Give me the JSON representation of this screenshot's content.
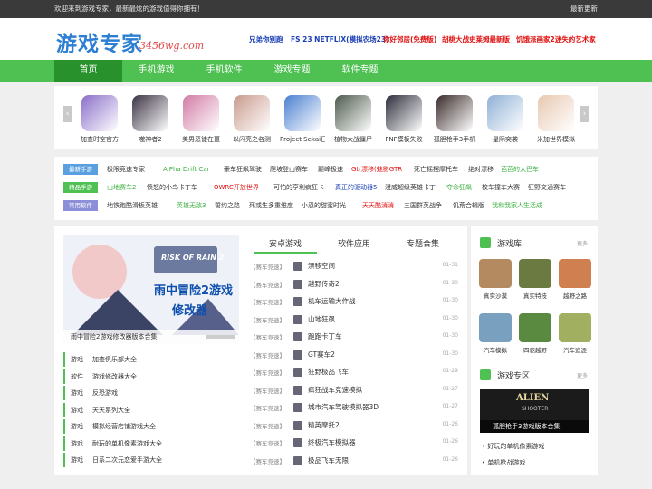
{
  "topbar": {
    "welcome": "欢迎来到游戏专家，最新最炫的游戏值得你拥有！",
    "latest": "最新更新"
  },
  "header": {
    "logo_cn": "游戏专家",
    "logo_en": "3456wg.com",
    "links": [
      {
        "text": "兄弟你别跑",
        "color": "#1a3fb5"
      },
      {
        "text": "FS 23 NETFLIX(模拟农场23)",
        "color": "#1a3fb5"
      },
      {
        "text": "你好邻居(免费版)",
        "color": "#e01010"
      },
      {
        "text": "胡桃大战史莱姆最新版",
        "color": "#e01010"
      },
      {
        "text": "饥饿派画家2迷失的艺术家",
        "color": "#e01010"
      }
    ]
  },
  "nav": [
    "首页",
    "手机游戏",
    "手机软件",
    "游戏专题",
    "软件专题"
  ],
  "carousel": {
    "items": [
      "加查时空官方",
      "噬神者2",
      "美男恶徒在噩",
      "以闪亮之名测",
      "Project Sekai日",
      "植物大战僵尸",
      "FNF模板失败",
      "孤胆枪手3手机",
      "星际突袭",
      "米加世界模拟"
    ],
    "colors": [
      "#8a6ec9",
      "#3b3343",
      "#d27aa4",
      "#c99a8d",
      "#4a7fd0",
      "#4d5a4d",
      "#2b2d3a",
      "#3a2a2a",
      "#8fb0d6",
      "#e8c8b0"
    ]
  },
  "tags": [
    {
      "label": "最新手游",
      "color": "#5aa0e0",
      "links": [
        {
          "t": "极限竞速专家",
          "c": "#333"
        },
        {
          "t": "AlPha Drift Car",
          "c": "#3cb040"
        },
        {
          "t": "豪车狂飙驾驶",
          "c": "#333"
        },
        {
          "t": "爬坡登山赛车",
          "c": "#333"
        },
        {
          "t": "巅峰极速",
          "c": "#333"
        },
        {
          "t": "Gtr漂移(魅影GTR",
          "c": "#e01010"
        },
        {
          "t": "死亡摇摆摩托车",
          "c": "#333"
        },
        {
          "t": "绝对漂移",
          "c": "#333"
        },
        {
          "t": "芭芭的大巴车",
          "c": "#3cb040"
        }
      ]
    },
    {
      "label": "精品手游",
      "color": "#4fc052",
      "links": [
        {
          "t": "山地赛车2",
          "c": "#3cb040"
        },
        {
          "t": "愤怒的小鸟卡丁车",
          "c": "#333"
        },
        {
          "t": "OWRC开放世界",
          "c": "#e01010"
        },
        {
          "t": "可怕的亨利疯狂卡",
          "c": "#333"
        },
        {
          "t": "真正的驱动器5",
          "c": "#1a3fb5"
        },
        {
          "t": "漫威超级英雄卡丁",
          "c": "#333"
        },
        {
          "t": "夺命狂飙",
          "c": "#3cb040"
        },
        {
          "t": "校车撞车大赛",
          "c": "#333"
        },
        {
          "t": "狂野交通赛车",
          "c": "#333"
        }
      ]
    },
    {
      "label": "常用软件",
      "color": "#8c8fd8",
      "links": [
        {
          "t": "地铁跑酷滑板英雄",
          "c": "#333"
        },
        {
          "t": "英雄无敌3",
          "c": "#3cb040"
        },
        {
          "t": "誓约之路",
          "c": "#333"
        },
        {
          "t": "死或生多重维度",
          "c": "#333"
        },
        {
          "t": "小忍的甜蜜时光",
          "c": "#333"
        },
        {
          "t": "天天酷消消",
          "c": "#e01010"
        },
        {
          "t": "三国群英战争",
          "c": "#333"
        },
        {
          "t": "饥荒合辑版",
          "c": "#333"
        },
        {
          "t": "我和我家人生活成",
          "c": "#3cb040"
        }
      ]
    }
  ],
  "featured": {
    "caption": "雨中冒险2游戏修改器版本合集",
    "banner_title": "雨中冒险2游戏",
    "banner_sub": "修改器",
    "logo": "RISK OF RAIN 2"
  },
  "tabs": [
    "安卓游戏",
    "软件应用",
    "专题合集"
  ],
  "list": [
    {
      "c": "【赛车竞速】",
      "t": "漂移空间",
      "d": "01-31"
    },
    {
      "c": "【赛车竞速】",
      "t": "越野传奇2",
      "d": "01-30"
    },
    {
      "c": "【赛车竞速】",
      "t": "机车运输大作战",
      "d": "01-30"
    },
    {
      "c": "【赛车竞速】",
      "t": "山地狂飙",
      "d": "01-30"
    },
    {
      "c": "【赛车竞速】",
      "t": "跑跑卡丁车",
      "d": "01-30"
    },
    {
      "c": "【赛车竞速】",
      "t": "GT赛车2",
      "d": "01-30"
    },
    {
      "c": "【赛车竞速】",
      "t": "狂野极品飞车",
      "d": "01-29"
    },
    {
      "c": "【赛车竞速】",
      "t": "疯狂战车竞速模拟",
      "d": "01-27"
    },
    {
      "c": "【赛车竞速】",
      "t": "城市汽车驾驶模拟器3D",
      "d": "01-27"
    },
    {
      "c": "【赛车竞速】",
      "t": "精英摩托2",
      "d": "01-26"
    },
    {
      "c": "【赛车竞速】",
      "t": "终极汽车模拟器",
      "d": "01-26"
    },
    {
      "c": "【赛车竞速】",
      "t": "极品飞车无限",
      "d": "01-26"
    }
  ],
  "leftlist": [
    {
      "k": "游戏",
      "v": "加查俱乐部大全"
    },
    {
      "k": "软件",
      "v": "游戏修改器大全"
    },
    {
      "k": "游戏",
      "v": "反恐游戏"
    },
    {
      "k": "游戏",
      "v": "天天系列大全"
    },
    {
      "k": "游戏",
      "v": "模拟经营店铺游戏大全"
    },
    {
      "k": "游戏",
      "v": "耐玩的单机像素游戏大全"
    },
    {
      "k": "游戏",
      "v": "日系二次元恋爱手游大全"
    }
  ],
  "right": {
    "lib_title": "游戏库",
    "more": "更多",
    "games": [
      "真实沙漠",
      "真实特技",
      "越野之路",
      "汽车模拟",
      "四驱越野",
      "汽车追逐"
    ],
    "game_colors": [
      "#b48a60",
      "#6a7a40",
      "#d08050",
      "#7aa0c0",
      "#5a8a40",
      "#a0b060"
    ],
    "zone_title": "游戏专区",
    "zone_banner": "ALIEN",
    "zone_banner_sub": "SHOOTER",
    "zone_caption": "孤胆枪手3游戏版本合集",
    "zone_links": [
      "好玩的单机像素游戏",
      "单机枪战游戏"
    ]
  }
}
